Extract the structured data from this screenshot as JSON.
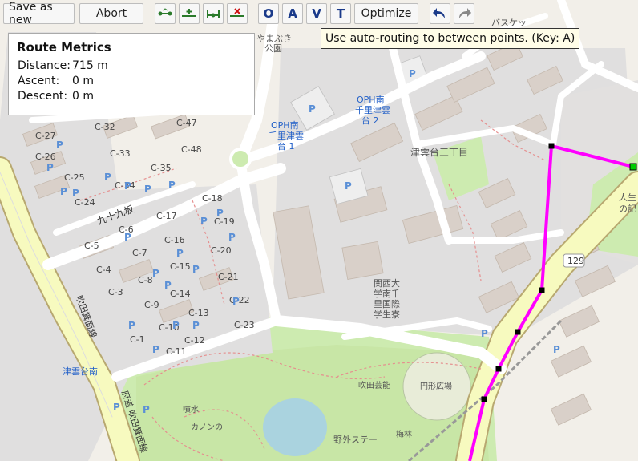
{
  "toolbar": {
    "save_as_new_label": "Save as new",
    "abort_label": "Abort",
    "tools": [
      "auto-route-icon",
      "add-point-icon",
      "split-segment-icon",
      "delete-point-icon"
    ],
    "letters": [
      "O",
      "A",
      "V",
      "T"
    ],
    "optimize_label": "Optimize",
    "undo_icon": "undo-icon",
    "redo_icon": "redo-icon"
  },
  "tooltip": "Use auto-routing to between points. (Key: A)",
  "metrics": {
    "title": "Route Metrics",
    "distance_label": "Distance:",
    "distance_value": "715 m",
    "ascent_label": "Ascent:",
    "ascent_value": "0 m",
    "descent_label": "Descent:",
    "descent_value": "0 m"
  },
  "map": {
    "route_color": "#ff00ff",
    "labels": {
      "basket": "バスケッ",
      "yamabuki1": "やまぶき",
      "yamabuki2": "公園",
      "oph1_1": "OPH南",
      "oph1_2": "千里津雲",
      "oph1_3": "台 1",
      "oph2_1": "OPH南",
      "oph2_2": "千里津雲",
      "oph2_3": "台 2",
      "tsukumodai": "津雲台三丁目",
      "kujukuzaka": "九十九坂",
      "kansai1": "関西大",
      "kansai2": "学南千",
      "kansai3": "里国際",
      "kansai4": "学生寮",
      "suita": "吹田芸能",
      "enkei": "円形広場",
      "tsukumo_s": "津雲台南",
      "yagai": "野外ステー",
      "umebayashi": "梅林",
      "shimohata": "噴水",
      "kanon": "カノンの",
      "suita_road1": "吹田箕面線",
      "suita_road2": "府道 吹田箕面線",
      "route129": "129",
      "jinsei": "人生",
      "kinen": "の記",
      "pix": "P"
    },
    "plots": [
      "C-27",
      "C-26",
      "C-25",
      "C-24",
      "C-32",
      "C-33",
      "C-34",
      "C-35",
      "C-47",
      "C-48",
      "C-18",
      "C-19",
      "C-20",
      "C-21",
      "C-22",
      "C-23",
      "C-17",
      "C-16",
      "C-15",
      "C-14",
      "C-13",
      "C-12",
      "C-11",
      "C-10",
      "C-9",
      "C-8",
      "C-7",
      "C-6",
      "C-5",
      "C-4",
      "C-3",
      "C-1"
    ]
  }
}
